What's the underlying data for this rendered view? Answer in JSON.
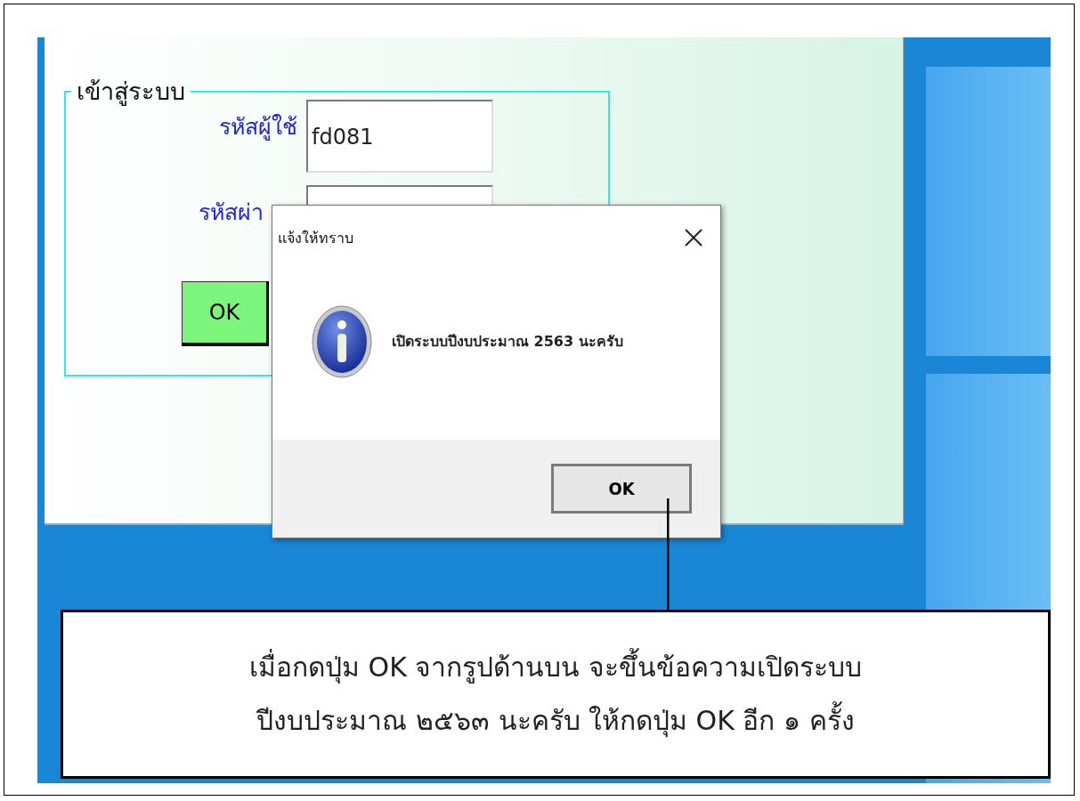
{
  "login_window": {
    "group_title": "เข้าสู่ระบบ",
    "fields": [
      {
        "label": "รหัสผู้ใช้",
        "value": "fd081"
      },
      {
        "label": "รหัสผ่า"
      }
    ],
    "ok_button": "OK"
  },
  "dialog": {
    "title": "แจ้งให้ทราบ",
    "message": "เปิดระบบปีงบประมาณ 2563 นะครับ",
    "button": "OK"
  },
  "callout": {
    "lines": [
      "เมื่อกดปุ่ม OK จากรูปด้านบน จะขึ้นข้อความเปิดระบบ",
      "ปีงบประมาณ ๒๕๖๓ นะครับ ให้กดปุ่ม OK อีก ๑ ครั้ง"
    ]
  }
}
